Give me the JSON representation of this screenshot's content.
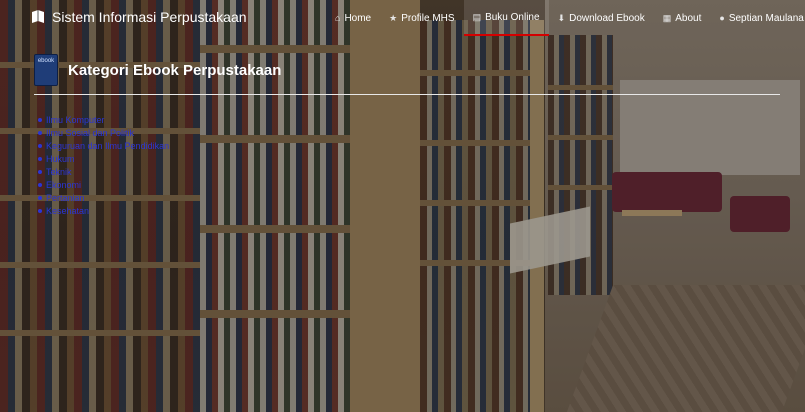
{
  "brand": {
    "title": "Sistem Informasi Perpustakaan",
    "icon": "book-icon"
  },
  "nav": {
    "items": [
      {
        "label": "Home",
        "icon": "home-icon",
        "active": false
      },
      {
        "label": "Profile MHS",
        "icon": "star-icon",
        "active": false
      },
      {
        "label": "Buku Online",
        "icon": "list-icon",
        "active": true
      },
      {
        "label": "Download Ebook",
        "icon": "download-icon",
        "active": false
      },
      {
        "label": "About",
        "icon": "info-icon",
        "active": false
      },
      {
        "label": "Septian Maulana",
        "icon": "user-icon",
        "active": false
      }
    ],
    "active_color": "#d40000"
  },
  "page": {
    "title": "Kategori Ebook Perpustakaan",
    "icon": "ebook-icon",
    "icon_text": "ebook"
  },
  "categories": [
    "Ilmu Komputer",
    "Ilmu Sosial dan Politik",
    "Keguruan dan Ilmu Pendidikan",
    "Hukum",
    "Teknik",
    "Ekonomi",
    "Pertanian",
    "Kesehatan"
  ],
  "colors": {
    "link": "#2b35d4",
    "text": "#ffffff"
  }
}
